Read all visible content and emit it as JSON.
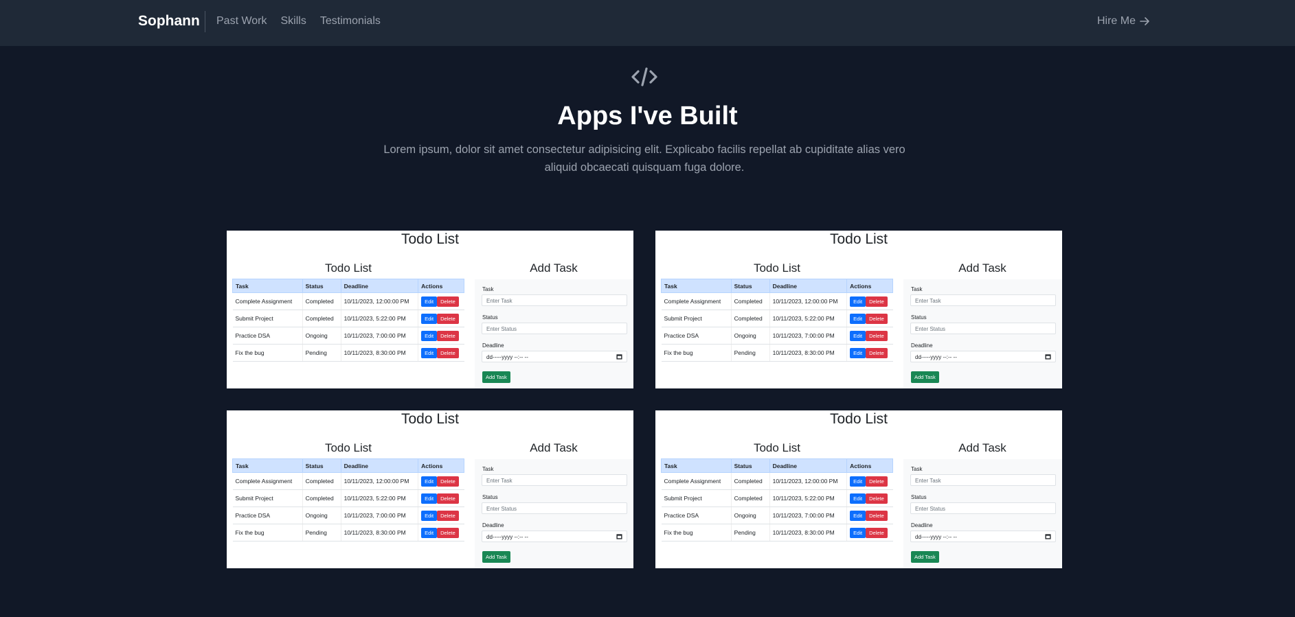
{
  "nav": {
    "brand": "Sophann",
    "links": [
      "Past Work",
      "Skills",
      "Testimonials"
    ],
    "hire_label": "Hire Me"
  },
  "hero": {
    "icon": "code-icon",
    "title": "Apps I've Built",
    "description": "Lorem ipsum, dolor sit amet consectetur adipisicing elit. Explicabo facilis repellat ab cupiditate alias vero aliquid obcaecati quisquam fuga dolore."
  },
  "card": {
    "title": "Todo List",
    "list_title": "Todo List",
    "add_title": "Add Task",
    "columns": [
      "Task",
      "Status",
      "Deadline",
      "Actions"
    ],
    "rows": [
      {
        "task": "Complete Assignment",
        "status": "Completed",
        "deadline": "10/11/2023, 12:00:00 PM"
      },
      {
        "task": "Submit Project",
        "status": "Completed",
        "deadline": "10/11/2023, 5:22:00 PM"
      },
      {
        "task": "Practice DSA",
        "status": "Ongoing",
        "deadline": "10/11/2023, 7:00:00 PM"
      },
      {
        "task": "Fix the bug",
        "status": "Pending",
        "deadline": "10/11/2023, 8:30:00 PM"
      }
    ],
    "edit_label": "Edit",
    "delete_label": "Delete",
    "form": {
      "task_label": "Task",
      "task_placeholder": "Enter Task",
      "status_label": "Status",
      "status_placeholder": "Enter Status",
      "deadline_label": "Deadline",
      "deadline_placeholder": "dd-----yyyy --:-- --",
      "submit_label": "Add Task"
    }
  },
  "colors": {
    "page_bg": "#111827",
    "nav_bg": "#1f2937",
    "edit": "#0d6efd",
    "delete": "#dc3545",
    "add": "#198754",
    "table_header": "#cfe2ff"
  }
}
